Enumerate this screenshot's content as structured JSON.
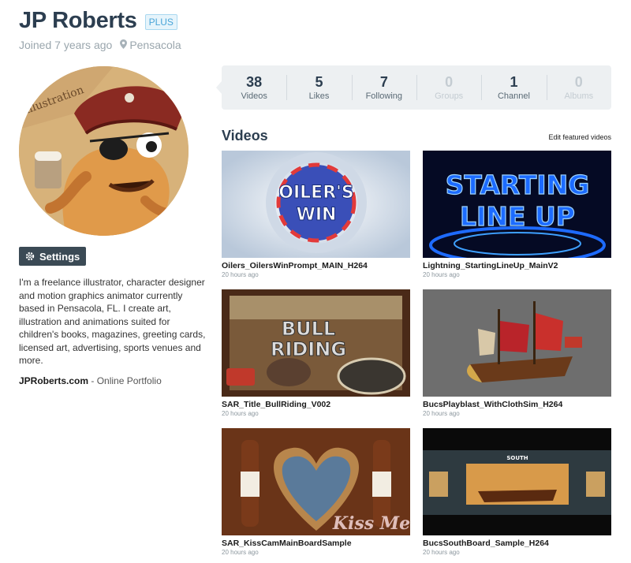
{
  "profile": {
    "name": "JP Roberts",
    "badge": "PLUS",
    "joined": "Joined 7 years ago",
    "location": "Pensacola",
    "settings_label": "Settings",
    "bio": "I'm a freelance illustrator, character designer and motion graphics animator currently based in Pensacola, FL. I create art, illustration and animations suited for children's books, magazines, greeting cards, licensed art, advertising, sports venues and more.",
    "portfolio_link": "JPRoberts.com",
    "portfolio_suffix": " - Online Portfolio"
  },
  "stats": [
    {
      "value": "38",
      "label": "Videos",
      "active": true
    },
    {
      "value": "5",
      "label": "Likes",
      "active": true
    },
    {
      "value": "7",
      "label": "Following",
      "active": true
    },
    {
      "value": "0",
      "label": "Groups",
      "active": false
    },
    {
      "value": "1",
      "label": "Channel",
      "active": true
    },
    {
      "value": "0",
      "label": "Albums",
      "active": false
    }
  ],
  "videos_section": {
    "title": "Videos",
    "edit_label": "Edit featured videos"
  },
  "videos": [
    {
      "title": "Oilers_OilersWinPrompt_MAIN_H264",
      "time": "20 hours ago"
    },
    {
      "title": "Lightning_StartingLineUp_MainV2",
      "time": "20 hours ago"
    },
    {
      "title": "SAR_Title_BullRiding_V002",
      "time": "20 hours ago"
    },
    {
      "title": "BucsPlayblast_WithClothSim_H264",
      "time": "20 hours ago"
    },
    {
      "title": "SAR_KissCamMainBoardSample",
      "time": "20 hours ago"
    },
    {
      "title": "BucsSouthBoard_Sample_H264",
      "time": "20 hours ago"
    }
  ],
  "thumb_text": {
    "oilers_1": "OILER'S",
    "oilers_2": "WIN",
    "lightning_1": "STARTING",
    "lightning_2": "LINE UP",
    "bull_1": "BULL",
    "bull_2": "RIDING",
    "kiss": "Kiss Me",
    "south": "SOUTH"
  },
  "colors": {
    "accent": "#4aa5d8",
    "title": "#2c3e50",
    "settings_bg": "#3b4a55",
    "stats_bg": "#edf0f2"
  }
}
